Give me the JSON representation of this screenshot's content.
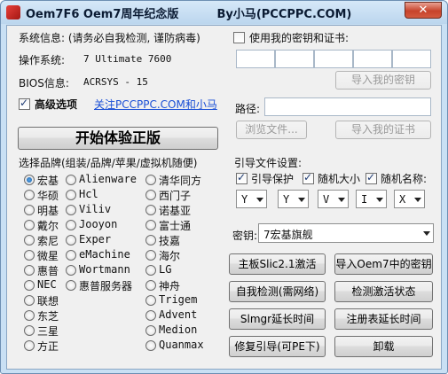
{
  "window": {
    "title": "Oem7F6 Oem7周年纪念版",
    "author": "By小马(PCCPPC.COM)",
    "close_glyph": "✕"
  },
  "sysinfo": {
    "header": "系统信息: (请务必自我检测, 谨防病毒)",
    "os_label": "操作系统:",
    "os_value": "7 Ultimate 7600",
    "bios_label": "BIOS信息:",
    "bios_value": "ACRSYS - 15"
  },
  "advanced": {
    "label": "高级选项",
    "checked": true,
    "link": "关注PCCPPC.COM和小马"
  },
  "start_button": "开始体验正版",
  "brand_header": "选择品牌(组装/品牌/苹果/虚拟机随便)",
  "brands": {
    "col1": [
      "宏基",
      "华硕",
      "明基",
      "戴尔",
      "索尼",
      "微星",
      "惠普",
      "NEC",
      "联想",
      "东芝",
      "三星",
      "方正"
    ],
    "col2": [
      "Alienware",
      "Hcl",
      "Viliv",
      "Jooyon",
      "Exper",
      "eMachine",
      "Wortmann",
      "惠普服务器"
    ],
    "col3": [
      "清华同方",
      "西门子",
      "诺基亚",
      "富士通",
      "技嘉",
      "海尔",
      "LG",
      "神舟",
      "Trigem",
      "Advent",
      "Medion",
      "Quanmax"
    ],
    "selected": "宏基"
  },
  "cert": {
    "use_own_label": "使用我的密钥和证书:",
    "use_own_checked": false,
    "import_key_button": "导入我的密钥",
    "path_label": "路径:",
    "browse_button": "浏览文件...",
    "import_cert_button": "导入我的证书"
  },
  "boot": {
    "header": "引导文件设置:",
    "protect_label": "引导保护",
    "random_size_label": "随机大小",
    "random_name_label": "随机名称:",
    "protect_checked": true,
    "random_size_checked": true,
    "random_name_checked": true,
    "name_chars": [
      "Y",
      "Y",
      "V",
      "I",
      "X"
    ]
  },
  "key": {
    "label": "密钥:",
    "value": "7宏基旗舰"
  },
  "actions": {
    "slic_activate": "主板Slic2.1激活",
    "import_oem7_key": "导入Oem7中的密钥",
    "self_check": "自我检测(需网络)",
    "check_activation": "检测激活状态",
    "slmgr_extend": "Slmgr延长时间",
    "registry_extend": "注册表延长时间",
    "repair_boot": "修复引导(可PE下)",
    "uninstall": "卸载"
  }
}
